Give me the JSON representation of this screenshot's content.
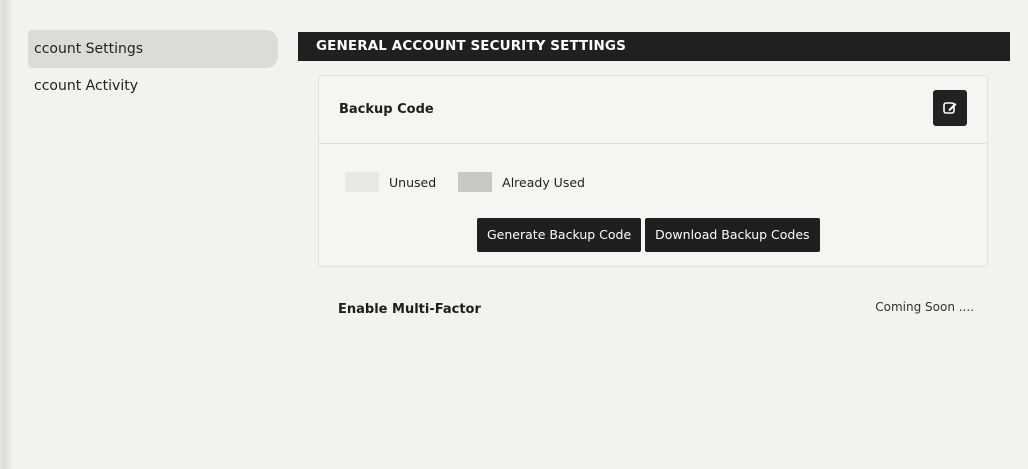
{
  "sidebar": {
    "items": [
      {
        "label": "ccount Settings",
        "active": true
      },
      {
        "label": "ccount Activity",
        "active": false
      }
    ]
  },
  "main": {
    "section_title": "GENERAL ACCOUNT SECURITY SETTINGS",
    "backup_card": {
      "title": "Backup Code",
      "edit_icon": "edit-icon",
      "legend": {
        "unused": "Unused",
        "used": "Already Used"
      },
      "buttons": {
        "generate": "Generate Backup Code",
        "download": "Download Backup Codes"
      }
    },
    "mfa": {
      "label": "Enable Multi-Factor",
      "status": "Coming Soon ...."
    }
  },
  "colors": {
    "header_bg": "#202020",
    "button_bg": "#1f1f1f",
    "page_bg": "#f3f2ee",
    "active_item_bg": "#dddbd6"
  }
}
